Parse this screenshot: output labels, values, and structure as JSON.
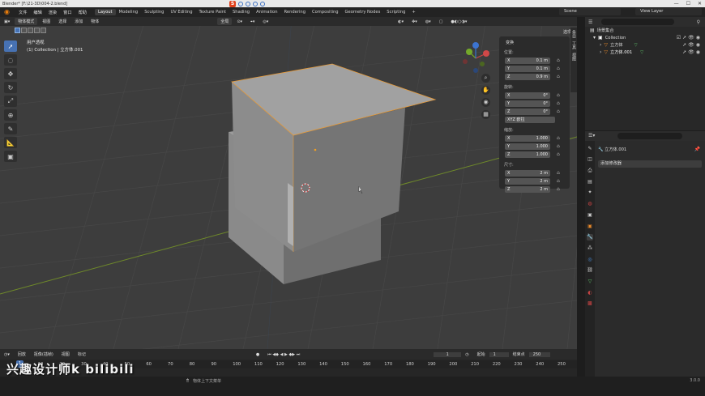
{
  "titlebar": {
    "title": "Blender* [F:\\21-3D\\004-2.blend]",
    "win_min": "—",
    "win_max": "☐",
    "win_close": "✕"
  },
  "menu": {
    "items": [
      "文件",
      "编辑",
      "渲染",
      "窗口",
      "帮助"
    ],
    "workspaces": [
      "Layout",
      "Modeling",
      "Sculpting",
      "UV Editing",
      "Texture Paint",
      "Shading",
      "Animation",
      "Rendering",
      "Compositing",
      "Geometry Nodes",
      "Scripting",
      "+"
    ],
    "active_workspace": "Layout",
    "scene": "Scene",
    "view_layer": "View Layer"
  },
  "viewport": {
    "mode": "物体模式",
    "menus": [
      "视图",
      "选择",
      "添加",
      "物体"
    ],
    "orientation": "全局",
    "overlay_line1": "用户透视",
    "overlay_line2": "(1) Collection | 立方体.001",
    "options_label": "选项"
  },
  "npanel": {
    "header": "变换",
    "location_label": "位置:",
    "location": [
      {
        "axis": "X",
        "value": "0.1 m"
      },
      {
        "axis": "Y",
        "value": "0.1 m"
      },
      {
        "axis": "Z",
        "value": "0.9 m"
      }
    ],
    "rotation_label": "旋转:",
    "rotation": [
      {
        "axis": "X",
        "value": "0°"
      },
      {
        "axis": "Y",
        "value": "0°"
      },
      {
        "axis": "Z",
        "value": "0°"
      }
    ],
    "rotation_mode": "XYZ 欧拉",
    "scale_label": "缩放:",
    "scale": [
      {
        "axis": "X",
        "value": "1.000"
      },
      {
        "axis": "Y",
        "value": "1.000"
      },
      {
        "axis": "Z",
        "value": "1.000"
      }
    ],
    "dims_label": "尺寸:",
    "dims": [
      {
        "axis": "X",
        "value": "2 m"
      },
      {
        "axis": "Y",
        "value": "2 m"
      },
      {
        "axis": "Z",
        "value": "2 m"
      }
    ],
    "side_tabs": [
      "条目",
      "工具",
      "视图"
    ]
  },
  "outliner": {
    "root": "场景集合",
    "collection": "Collection",
    "objects": [
      "立方体",
      "立方体.001"
    ]
  },
  "properties": {
    "object_name": "立方体.001",
    "add_modifier": "添加修改器"
  },
  "timeline": {
    "menus": [
      "回放",
      "抠像(插帧)",
      "视图",
      "标记"
    ],
    "current_frame": "1",
    "start_label": "起始",
    "start": "1",
    "end_label": "结束点",
    "end": "250",
    "ticks": [
      "1",
      "10",
      "20",
      "30",
      "40",
      "50",
      "60",
      "70",
      "80",
      "90",
      "100",
      "110",
      "120",
      "130",
      "140",
      "150",
      "160",
      "170",
      "180",
      "190",
      "200",
      "210",
      "220",
      "230",
      "240",
      "250"
    ]
  },
  "statusbar": {
    "hint": "物体上下文菜单",
    "version": "3.0.0"
  },
  "watermark": "兴趣设计师k  bilibili",
  "colors": {
    "accent": "#4772b3",
    "orange": "#e87d0d",
    "bg_viewport": "#3f3f3f"
  }
}
